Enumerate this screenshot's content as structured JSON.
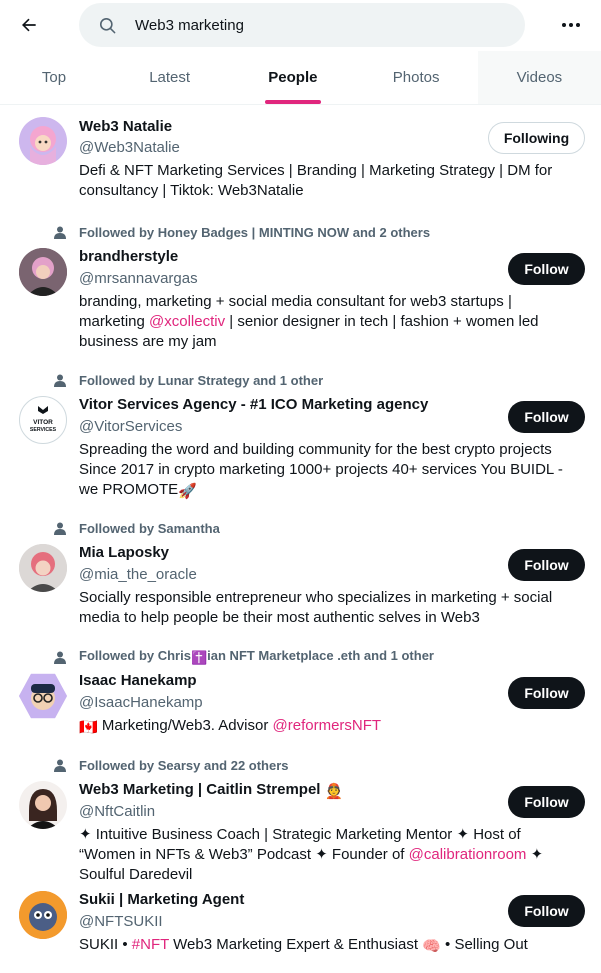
{
  "search": {
    "query": "Web3 marketing"
  },
  "tabs": [
    {
      "label": "Top"
    },
    {
      "label": "Latest"
    },
    {
      "label": "People"
    },
    {
      "label": "Photos"
    },
    {
      "label": "Videos"
    }
  ],
  "colors": {
    "accent": "#e0267d",
    "text": "#0f1419",
    "muted": "#536471",
    "search_bg": "#eff3f4"
  },
  "users": [
    {
      "social": "",
      "name": "Web3 Natalie",
      "handle": "@Web3Natalie",
      "bio_1": "Defi & NFT Marketing Services | Branding | Marketing Strategy | DM for",
      "bio_2": "consultancy | Tiktok: Web3Natalie",
      "button": "Following"
    },
    {
      "social": "Followed by Honey Badges | MINTING NOW and 2 others",
      "name": "brandherstyle",
      "handle": "@mrsannavargas",
      "bio_1": "branding, marketing + social media consultant for web3 startups |",
      "bio_2a": "marketing ",
      "bio_2_mention": "@xcollectiv",
      "bio_2b": " | senior designer in tech | fashion + women led",
      "bio_3": "business are my jam",
      "button": "Follow"
    },
    {
      "social": "Followed by Lunar Strategy and 1 other",
      "name": "Vitor Services Agency - #1 ICO Marketing agency",
      "handle": "@VitorServices",
      "avatar_text": "VITOR SERVICES",
      "bio_1": "Spreading the word and building community for the best crypto projects",
      "bio_2": "Since 2017 in crypto marketing 1000+ projects 40+ services You BUIDL -",
      "bio_3": "we PROMOTE",
      "bio_3_emoji": "🚀",
      "button": "Follow"
    },
    {
      "social": "Followed by Samantha",
      "name": "Mia Laposky",
      "handle": "@mia_the_oracle",
      "bio_1": "Socially responsible entrepreneur who specializes in marketing + social",
      "bio_2": "media to help people be their most authentic selves in Web3",
      "button": "Follow"
    },
    {
      "social_a": "Followed by Chris",
      "social_emoji": "✝️",
      "social_b": "ian NFT Marketplace .eth and 1 other",
      "name": "Isaac Hanekamp",
      "handle": "@IsaacHanekamp",
      "bio_flag": "🇨🇦",
      "bio_1": " Marketing/Web3. Advisor ",
      "bio_1_mention": "@reformersNFT",
      "button": "Follow"
    },
    {
      "social": "Followed by Searsy and 22 others",
      "name": "Web3 Marketing | Caitlin Strempel",
      "name_emoji": "👲",
      "handle": "@NftCaitlin",
      "bio_1": "✦ Intuitive Business Coach | Strategic Marketing Mentor ✦ Host of",
      "bio_2": "“Women in NFTs & Web3” Podcast ✦ Founder of ",
      "bio_2_mention": "@calibrationroom",
      "bio_2_end": " ✦",
      "bio_3": "Soulful Daredevil",
      "button": "Follow"
    },
    {
      "social": "",
      "name": "Sukii | Marketing Agent",
      "handle": "@NFTSUKII",
      "bio_1a": "SUKII • ",
      "bio_1_mention": "#NFT",
      "bio_1b": " Web3 Marketing Expert & Enthusiast ",
      "bio_1_emoji": "🧠",
      "bio_1c": " • Selling Out",
      "button": "Follow"
    }
  ]
}
